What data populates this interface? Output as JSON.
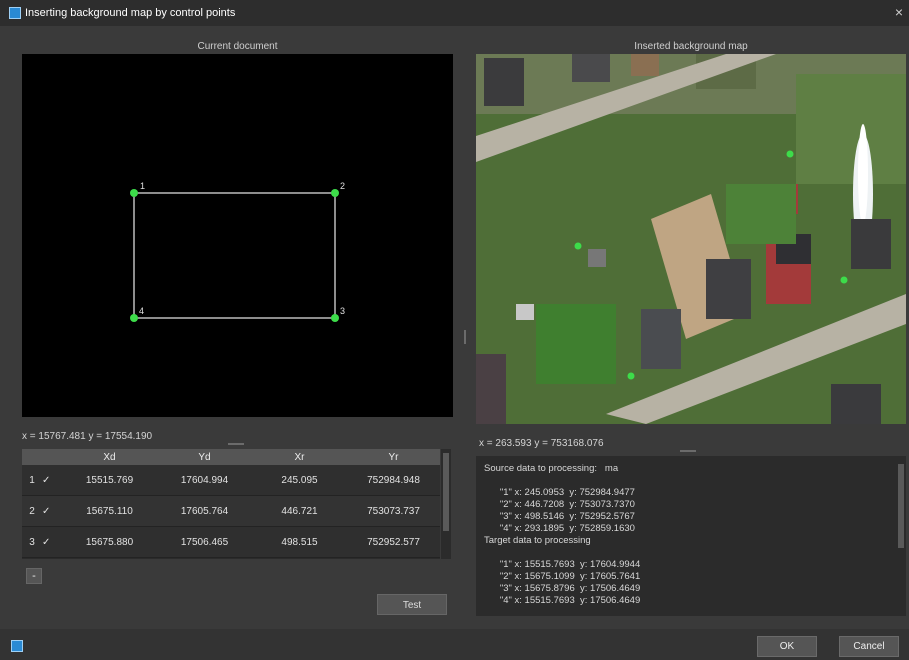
{
  "window": {
    "title": "Inserting background map by control points",
    "close_glyph": "×"
  },
  "left_pane": {
    "caption": "Current document",
    "points": [
      {
        "label": "1"
      },
      {
        "label": "2"
      },
      {
        "label": "3"
      },
      {
        "label": "4"
      }
    ],
    "cursor_readout": "x = 15767.481 y = 17554.190"
  },
  "right_pane": {
    "caption": "Inserted background map",
    "cursor_readout": "x = 263.593 y = 753168.076"
  },
  "table": {
    "columns": [
      "Xd",
      "Yd",
      "Xr",
      "Yr"
    ],
    "rows": [
      {
        "index": "1",
        "check": "✓",
        "xd": "15515.769",
        "yd": "17604.994",
        "xr": "245.095",
        "yr": "752984.948"
      },
      {
        "index": "2",
        "check": "✓",
        "xd": "15675.110",
        "yd": "17605.764",
        "xr": "446.721",
        "yr": "753073.737"
      },
      {
        "index": "3",
        "check": "✓",
        "xd": "15675.880",
        "yd": "17506.465",
        "xr": "498.515",
        "yr": "752952.577"
      }
    ]
  },
  "buttons": {
    "minus": "-",
    "test": "Test",
    "ok": "OK",
    "cancel": "Cancel"
  },
  "log": {
    "lines": [
      "Source data to processing:   ma",
      "",
      "      \"1\" x: 245.0953  y: 752984.9477",
      "      \"2\" x: 446.7208  y: 753073.7370",
      "      \"3\" x: 498.5146  y: 752952.5767",
      "      \"4\" x: 293.1895  y: 752859.1630",
      "Target data to processing",
      "",
      "      \"1\" x: 15515.7693  y: 17604.9944",
      "      \"2\" x: 15675.1099  y: 17605.7641",
      "      \"3\" x: 15675.8796  y: 17506.4649",
      "      \"4\" x: 15515.7693  y: 17506.4649"
    ]
  },
  "colors": {
    "point_marker": "#3ddc4a",
    "accent": "#2a8ad4"
  }
}
